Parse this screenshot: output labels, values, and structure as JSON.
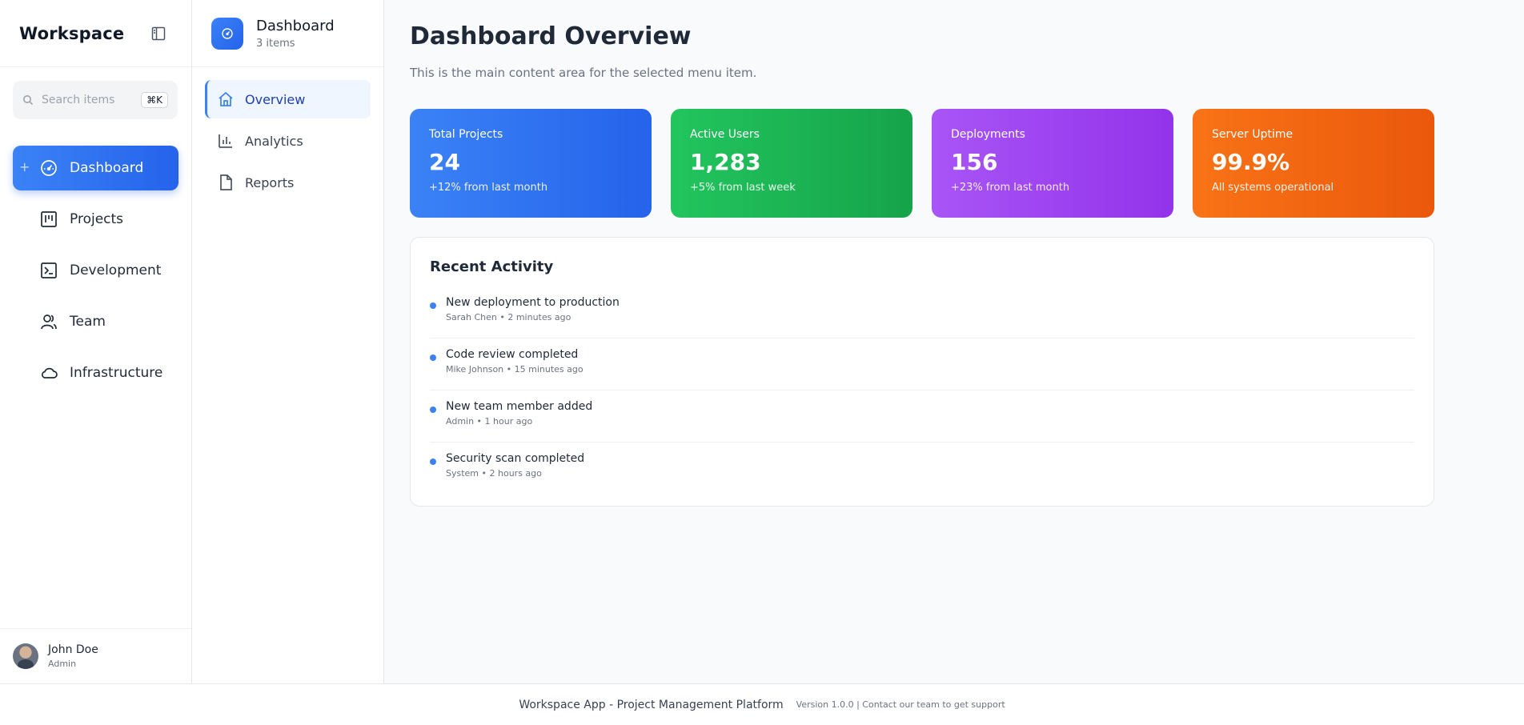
{
  "app": {
    "brand": "Workspace"
  },
  "search": {
    "placeholder": "Search items",
    "shortcut": "⌘K"
  },
  "sidebar": {
    "items": [
      {
        "label": "Dashboard",
        "icon": "gauge-icon",
        "active": true
      },
      {
        "label": "Projects",
        "icon": "kanban-icon"
      },
      {
        "label": "Development",
        "icon": "terminal-icon"
      },
      {
        "label": "Team",
        "icon": "users-icon"
      },
      {
        "label": "Infrastructure",
        "icon": "cloud-icon"
      }
    ],
    "user": {
      "name": "John Doe",
      "role": "Admin"
    }
  },
  "subnav": {
    "title": "Dashboard",
    "count": "3 items",
    "items": [
      {
        "label": "Overview",
        "icon": "home-icon",
        "active": true
      },
      {
        "label": "Analytics",
        "icon": "bar-chart-icon"
      },
      {
        "label": "Reports",
        "icon": "document-icon"
      }
    ]
  },
  "main": {
    "title": "Dashboard Overview",
    "description": "This is the main content area for the selected menu item.",
    "stats": [
      {
        "label": "Total Projects",
        "value": "24",
        "change": "+12% from last month",
        "color": "#3b82f6"
      },
      {
        "label": "Active Users",
        "value": "1,283",
        "change": "+5% from last week",
        "color": "#22c55e"
      },
      {
        "label": "Deployments",
        "value": "156",
        "change": "+23% from last month",
        "color": "#a855f7"
      },
      {
        "label": "Server Uptime",
        "value": "99.9%",
        "change": "All systems operational",
        "color": "#f97316"
      }
    ],
    "activity": {
      "title": "Recent Activity",
      "items": [
        {
          "text": "New deployment to production",
          "meta": "Sarah Chen • 2 minutes ago"
        },
        {
          "text": "Code review completed",
          "meta": "Mike Johnson • 15 minutes ago"
        },
        {
          "text": "New team member added",
          "meta": "Admin • 1 hour ago"
        },
        {
          "text": "Security scan completed",
          "meta": "System • 2 hours ago"
        }
      ]
    }
  },
  "footer": {
    "app_text": "Workspace App - Project Management Platform",
    "version_text": "Version 1.0.0 | Contact our team to get support"
  }
}
